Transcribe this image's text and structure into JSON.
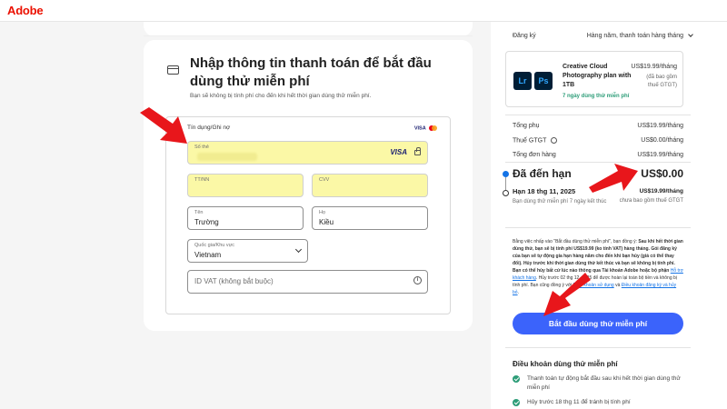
{
  "header": {
    "logo": "Adobe"
  },
  "payment": {
    "title": "Nhập thông tin thanh toán để bắt đầu dùng thử miễn phí",
    "subtitle": "Bạn sẽ không bị tính phí cho đến khi hết thời gian dùng thử miễn phí.",
    "method_label": "Tín dụng/Ghi nợ",
    "card_brands": "VISA",
    "fields": {
      "card_number_label": "Số thẻ",
      "card_badge": "VISA",
      "expiry_label": "TT/NN",
      "cvv_label": "CVV",
      "first_name_label": "Tên",
      "first_name_value": "Trường",
      "last_name_label": "Họ",
      "last_name_value": "Kiều",
      "country_label": "Quốc gia/Khu vực",
      "country_value": "Vietnam",
      "vat_placeholder": "ID VAT (không bắt buộc)",
      "info_glyph": "i"
    }
  },
  "summary": {
    "subscription_label": "Đăng ký",
    "subscription_value": "Hàng năm, thanh toán hàng tháng",
    "plan": {
      "icon_lr": "Lr",
      "icon_ps": "Ps",
      "name": "Creative Cloud Photography plan with 1TB",
      "trial": "7 ngày dùng thử miễn phí",
      "price": "US$19.99/tháng",
      "tax_note": "(đã bao gồm thuế GTGT)"
    },
    "subtotal_label": "Tổng phụ",
    "subtotal_value": "US$19.99/tháng",
    "vat_label": "Thuế GTGT",
    "vat_value": "US$0.00/tháng",
    "total_label": "Tổng đơn hàng",
    "total_value": "US$19.99/tháng",
    "due_today_label": "Đã đến hạn",
    "due_today_value": "US$0.00",
    "due_date_label": "Hạn 18 thg 11, 2025",
    "due_date_note": "Bạn dùng thử miễn phí 7 ngày kết thúc",
    "due_date_price": "US$19.99/tháng",
    "due_date_tax": "chưa bao gồm thuế GTGT",
    "legal": {
      "p1": "Bằng việc nhấp vào \"Bắt đầu dùng thử miễn phí\", bạn đồng ý: ",
      "b1": "Sau khi hết thời gian dùng thử, bạn sẽ bị tính phí US$19.99 (ko tính VAT) hàng tháng. Gói đăng ký của bạn sẽ tự động gia hạn hàng năm cho đến khi bạn hủy (giá có thể thay đổi). Hủy trước khi thời gian dùng thử kết thúc và bạn sẽ không bị tính phí. Bạn có thể hủy bất cứ lúc nào thông qua Tài khoản Adobe hoặc bộ phận",
      "link1": "Hỗ trợ khách hàng",
      "p2": ". Hủy trước 02 thg 12, 2025 để được hoàn lại toàn bộ tiền và không bị tính phí. Bạn cũng đồng ý với",
      "link2": "Điều khoản sử dụng",
      "p3": " và ",
      "link3": "Điều khoản đăng ký và hủy bỏ",
      "p4": "."
    },
    "cta": "Bắt đầu dùng thử miễn phí",
    "terms_title": "Điều khoản dùng thử miễn phí",
    "terms": [
      "Thanh toán tự động bắt đầu sau khi hết thời gian dùng thử miễn phí",
      "Hủy trước 18 thg 11 để tránh bị tính phí"
    ]
  },
  "colors": {
    "accent": "#3b63fb",
    "autofill": "#fbf8a6",
    "arrow": "#e8161b",
    "brand": "#eb1000"
  }
}
